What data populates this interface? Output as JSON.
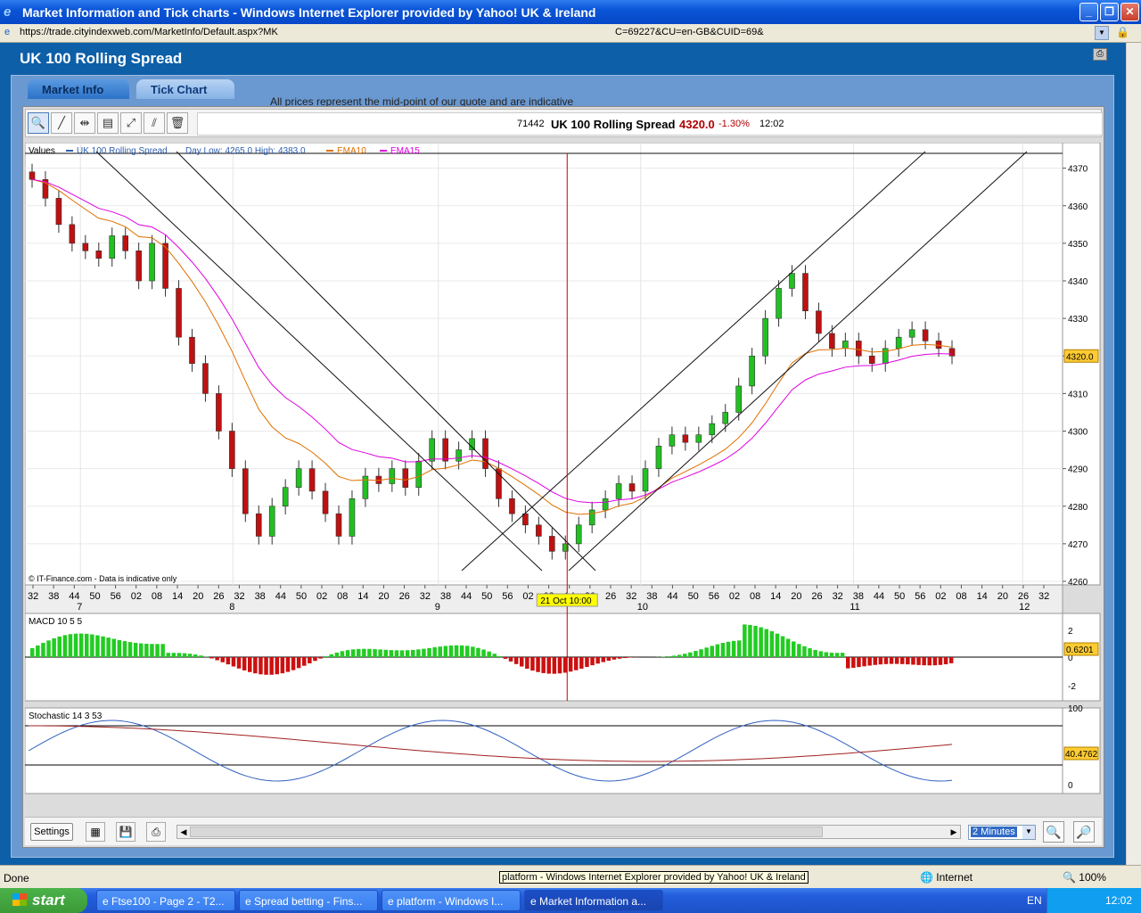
{
  "window": {
    "title": "Market Information and Tick charts - Windows Internet Explorer provided by Yahoo! UK & Ireland"
  },
  "address": {
    "url": "https://trade.cityindexweb.com/MarketInfo/Default.aspx?MK",
    "url_tail": "C=69227&CU=en-GB&CUID=69&"
  },
  "app": {
    "title": "UK 100 Rolling Spread",
    "note": "All prices represent the mid-point of our quote and are indicative"
  },
  "tabs": [
    {
      "label": "Market Info"
    },
    {
      "label": "Tick Chart"
    }
  ],
  "quote": {
    "id": "71442",
    "name": "UK 100 Rolling Spread",
    "price": "4320.0",
    "change": "-1.30%",
    "time": "12:02"
  },
  "legend": {
    "values": "Values",
    "series": "UK 100 Rolling Spread",
    "daylowhigh": "Day Low: 4265.0 High: 4383.0",
    "ema10": "EMA10",
    "ema15": "EMA15"
  },
  "credit": "© IT-Finance.com - Data is indicative only",
  "crosshair_label": "21 Oct 10:00",
  "price_label": "4320.0",
  "macd": {
    "label": "MACD 10 5 5",
    "value": "0.6201"
  },
  "stoch": {
    "label": "Stochastic 14 3 53",
    "value": "40.4762"
  },
  "chart_data": {
    "type": "candlestick",
    "title": "UK 100 Rolling Spread",
    "y_ticks": [
      4370,
      4360,
      4350,
      4340,
      4330,
      4320,
      4310,
      4300,
      4290,
      4280,
      4270,
      4260
    ],
    "ylim": [
      4260,
      4373
    ],
    "x_time_ticks": [
      "32",
      "38",
      "44",
      "50",
      "56",
      "02",
      "08",
      "14",
      "20",
      "26",
      "32",
      "38",
      "44",
      "50",
      "02",
      "08",
      "14",
      "20",
      "26",
      "32",
      "38",
      "44",
      "50",
      "56",
      "02",
      "08",
      "14",
      "20",
      "26",
      "32",
      "38",
      "44",
      "50",
      "56",
      "02",
      "08",
      "14",
      "20",
      "26",
      "32",
      "38",
      "44",
      "50",
      "56",
      "02",
      "08",
      "14",
      "20",
      "26",
      "32"
    ],
    "x_day_ticks": [
      "7",
      "8",
      "9",
      "10",
      "11",
      "12"
    ],
    "last_price": 4320.0,
    "close_estimates": [
      4367,
      4362,
      4355,
      4350,
      4348,
      4346,
      4352,
      4348,
      4340,
      4350,
      4338,
      4325,
      4318,
      4310,
      4300,
      4290,
      4278,
      4272,
      4280,
      4285,
      4290,
      4284,
      4278,
      4272,
      4282,
      4288,
      4286,
      4290,
      4285,
      4292,
      4298,
      4292,
      4295,
      4298,
      4290,
      4282,
      4278,
      4275,
      4272,
      4268,
      4270,
      4275,
      4279,
      4282,
      4286,
      4284,
      4290,
      4296,
      4299,
      4297,
      4299,
      4302,
      4305,
      4312,
      4320,
      4330,
      4338,
      4342,
      4332,
      4326,
      4322,
      4324,
      4320,
      4318,
      4322,
      4325,
      4327,
      4324,
      4322,
      4320
    ],
    "macd_ylim": [
      -3,
      3
    ],
    "macd_ticks": [
      2,
      0,
      -2
    ],
    "stoch_ticks": [
      100,
      50,
      0
    ]
  },
  "bottom": {
    "settings": "Settings",
    "interval": "2 Minutes"
  },
  "status": {
    "done": "Done",
    "tooltip": "platform - Windows Internet Explorer provided by Yahoo! UK & Ireland",
    "zone": "Internet",
    "zoom": "100%"
  },
  "taskbar": {
    "start": "start",
    "tasks": [
      {
        "label": "Ftse100 - Page 2 - T2..."
      },
      {
        "label": "Spread betting - Fins..."
      },
      {
        "label": "platform - Windows I..."
      },
      {
        "label": "Market Information a..."
      }
    ],
    "lang": "EN",
    "clock": "12:02"
  }
}
